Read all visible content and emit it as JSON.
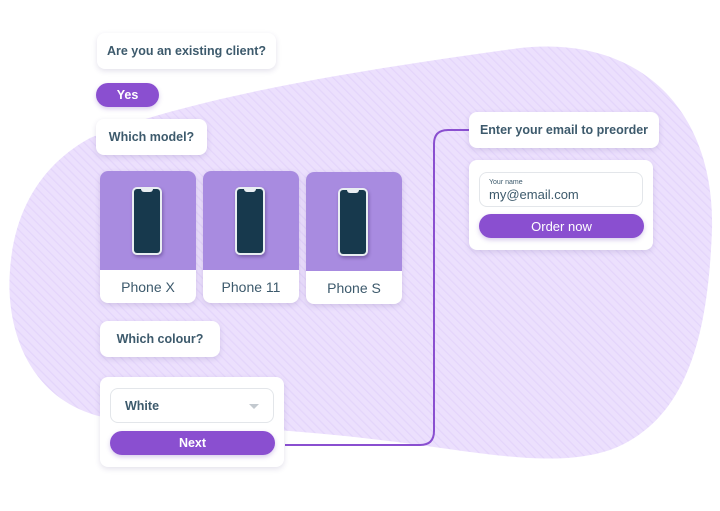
{
  "colors": {
    "accent": "#8a4fd0",
    "blob": "#ece0fd",
    "phone_bg": "#a88be0",
    "text": "#3d5a6c"
  },
  "chat": {
    "q_existing_client": "Are you an existing client?",
    "answer_yes": "Yes",
    "q_model": "Which model?",
    "phones": [
      {
        "label": "Phone X",
        "icon": "smartphone-icon"
      },
      {
        "label": "Phone 11",
        "icon": "smartphone-icon"
      },
      {
        "label": "Phone S",
        "icon": "smartphone-icon"
      }
    ],
    "q_colour": "Which colour?",
    "colour_select": {
      "value": "White",
      "icon": "chevron-down-icon"
    },
    "next_label": "Next",
    "q_email": "Enter your email to preorder",
    "email_field": {
      "label": "Your name",
      "value": "my@email.com"
    },
    "order_label": "Order now"
  }
}
